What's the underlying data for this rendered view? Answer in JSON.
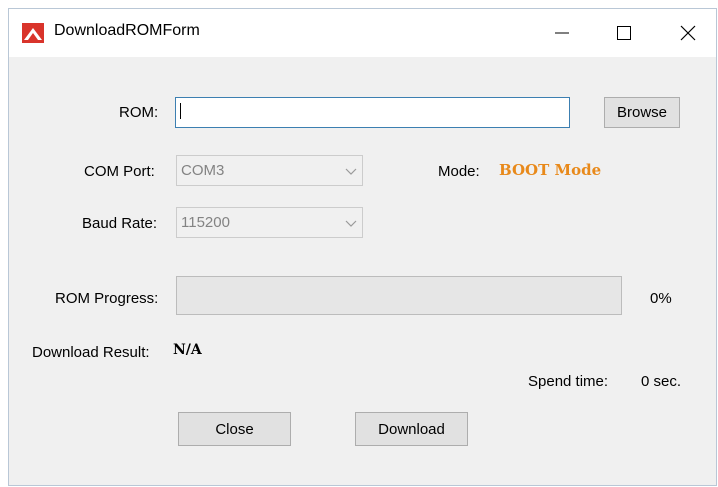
{
  "window": {
    "title": "DownloadROMForm",
    "icon": "app-icon"
  },
  "rom": {
    "label": "ROM:",
    "value": "",
    "browse_label": "Browse"
  },
  "com_port": {
    "label": "COM Port:",
    "selected": "COM3"
  },
  "mode": {
    "label": "Mode:",
    "value": "BOOT Mode",
    "color": "#e8891a"
  },
  "baud_rate": {
    "label": "Baud Rate:",
    "selected": "115200"
  },
  "rom_progress": {
    "label": "ROM Progress:",
    "percent_text": "0%",
    "progress_fraction": 0
  },
  "download_result": {
    "label": "Download Result:",
    "value": "N/A"
  },
  "spend_time": {
    "label": "Spend time:",
    "value": "0 sec."
  },
  "actions": {
    "close_label": "Close",
    "download_label": "Download"
  }
}
